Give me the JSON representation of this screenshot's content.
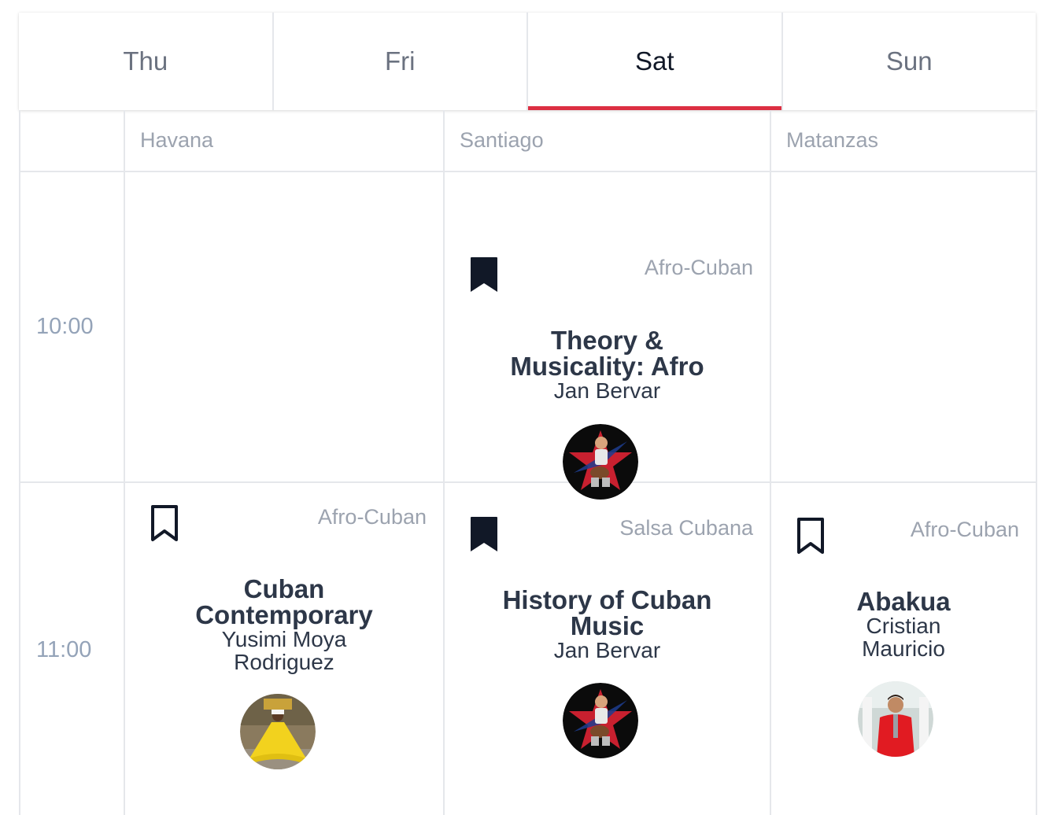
{
  "tabs": [
    {
      "label": "Thu",
      "active": false
    },
    {
      "label": "Fri",
      "active": false
    },
    {
      "label": "Sat",
      "active": true
    },
    {
      "label": "Sun",
      "active": false
    }
  ],
  "columns": [
    "Havana",
    "Santiago",
    "Matanzas"
  ],
  "times": [
    "10:00",
    "11:00"
  ],
  "sessions": [
    {
      "room": "Santiago",
      "time": "10:00",
      "category": "Afro-Cuban",
      "title": "Theory & Musicality: Afro",
      "teacher": "Jan Bervar",
      "bookmarked": true,
      "avatar": "teacher-photo-jan-bervar"
    },
    {
      "room": "Havana",
      "time": "11:00",
      "category": "Afro-Cuban",
      "title": "Cuban Contemporary",
      "teacher": "Yusimi Moya Rodriguez",
      "bookmarked": false,
      "avatar": "teacher-photo-yusimi-moya-rodriguez"
    },
    {
      "room": "Santiago",
      "time": "11:00",
      "category": "Salsa Cubana",
      "title": "History of Cuban Music",
      "teacher": "Jan Bervar",
      "bookmarked": true,
      "avatar": "teacher-photo-jan-bervar"
    },
    {
      "room": "Matanzas",
      "time": "11:00",
      "category": "Afro-Cuban",
      "title": "Abakua",
      "teacher": "Cristian Mauricio",
      "bookmarked": false,
      "avatar": "teacher-photo-cristian-mauricio"
    }
  ],
  "colors": {
    "accent": "#dc2f42",
    "muted_text": "#9ca3af",
    "text": "#2d3748",
    "border": "#e5e7eb"
  }
}
